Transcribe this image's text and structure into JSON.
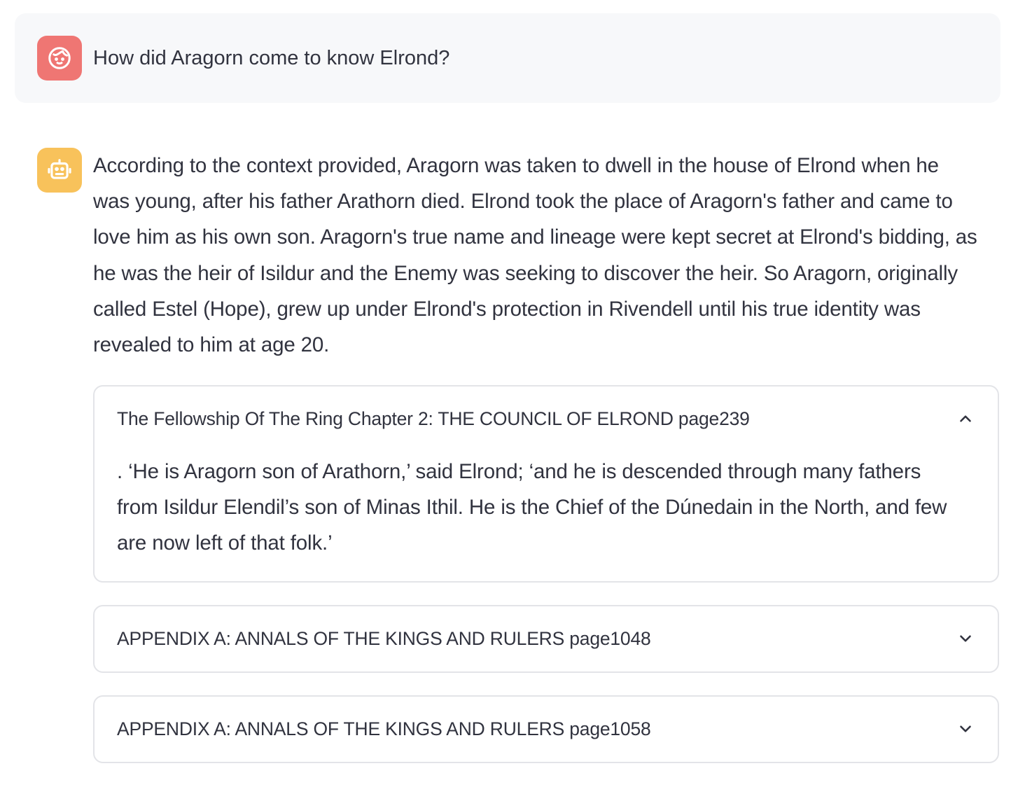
{
  "user_message": {
    "avatar_icon": "user-face-icon",
    "avatar_color": "#ef7673",
    "text": "How did Aragorn come to know Elrond?"
  },
  "assistant_message": {
    "avatar_icon": "robot-icon",
    "avatar_color": "#f8c25b",
    "lines": [
      "According to the context provided, Aragorn was taken to dwell in the house of Elrond when he",
      "was young, after his father Arathorn died. Elrond took the place of Aragorn's father and came to",
      "love him as his own son. Aragorn's true name and lineage were kept secret at Elrond's bidding, as",
      "he was the heir of Isildur and the Enemy was seeking to discover the heir. So Aragorn, originally",
      "called Estel (Hope), grew up under Elrond's protection in Rivendell until his true identity was",
      "revealed to him at age 20."
    ]
  },
  "sources": [
    {
      "label": "The Fellowship Of The Ring Chapter 2: THE COUNCIL OF ELROND page239",
      "expanded": true,
      "chevron_icon": "chevron-up-icon",
      "content_lines": [
        ". ‘He is Aragorn son of Arathorn,’ said Elrond; ‘and he is descended through many fathers",
        "from Isildur Elendil’s son of Minas Ithil. He is the Chief of the Dúnedain in the North, and few",
        "are now left of that folk.’"
      ]
    },
    {
      "label": "APPENDIX A: ANNALS OF THE KINGS AND RULERS page1048",
      "expanded": false,
      "chevron_icon": "chevron-down-icon"
    },
    {
      "label": "APPENDIX A: ANNALS OF THE KINGS AND RULERS page1058",
      "expanded": false,
      "chevron_icon": "chevron-down-icon"
    }
  ]
}
